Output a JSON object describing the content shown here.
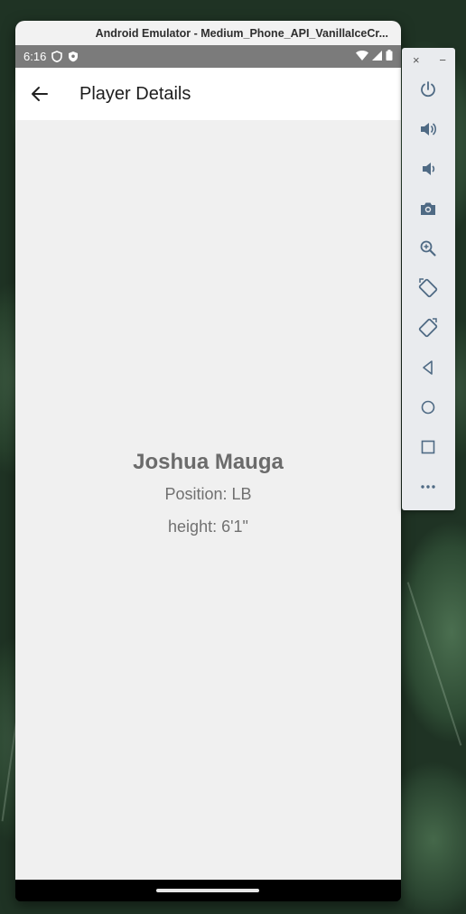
{
  "window": {
    "title": "Android Emulator - Medium_Phone_API_VanillaIceCr..."
  },
  "status_bar": {
    "time": "6:16"
  },
  "app_bar": {
    "title": "Player Details"
  },
  "player": {
    "name": "Joshua Mauga",
    "position": "Position: LB",
    "height": "height: 6'1\""
  },
  "toolbar": {
    "close_label": "×",
    "minimize_label": "−",
    "buttons": [
      "power-icon",
      "volume-up-icon",
      "volume-down-icon",
      "camera-icon",
      "zoom-in-icon",
      "rotate-left-icon",
      "rotate-right-icon",
      "back-icon",
      "home-icon",
      "overview-icon",
      "more-icon"
    ]
  },
  "colors": {
    "status_bar": "#7b7b7b",
    "app_bar": "#ffffff",
    "content_bg": "#f0f0f0",
    "name_text": "#6b6b6b",
    "toolbar_bg": "#e9ebee",
    "icon": "#4f6a84"
  }
}
